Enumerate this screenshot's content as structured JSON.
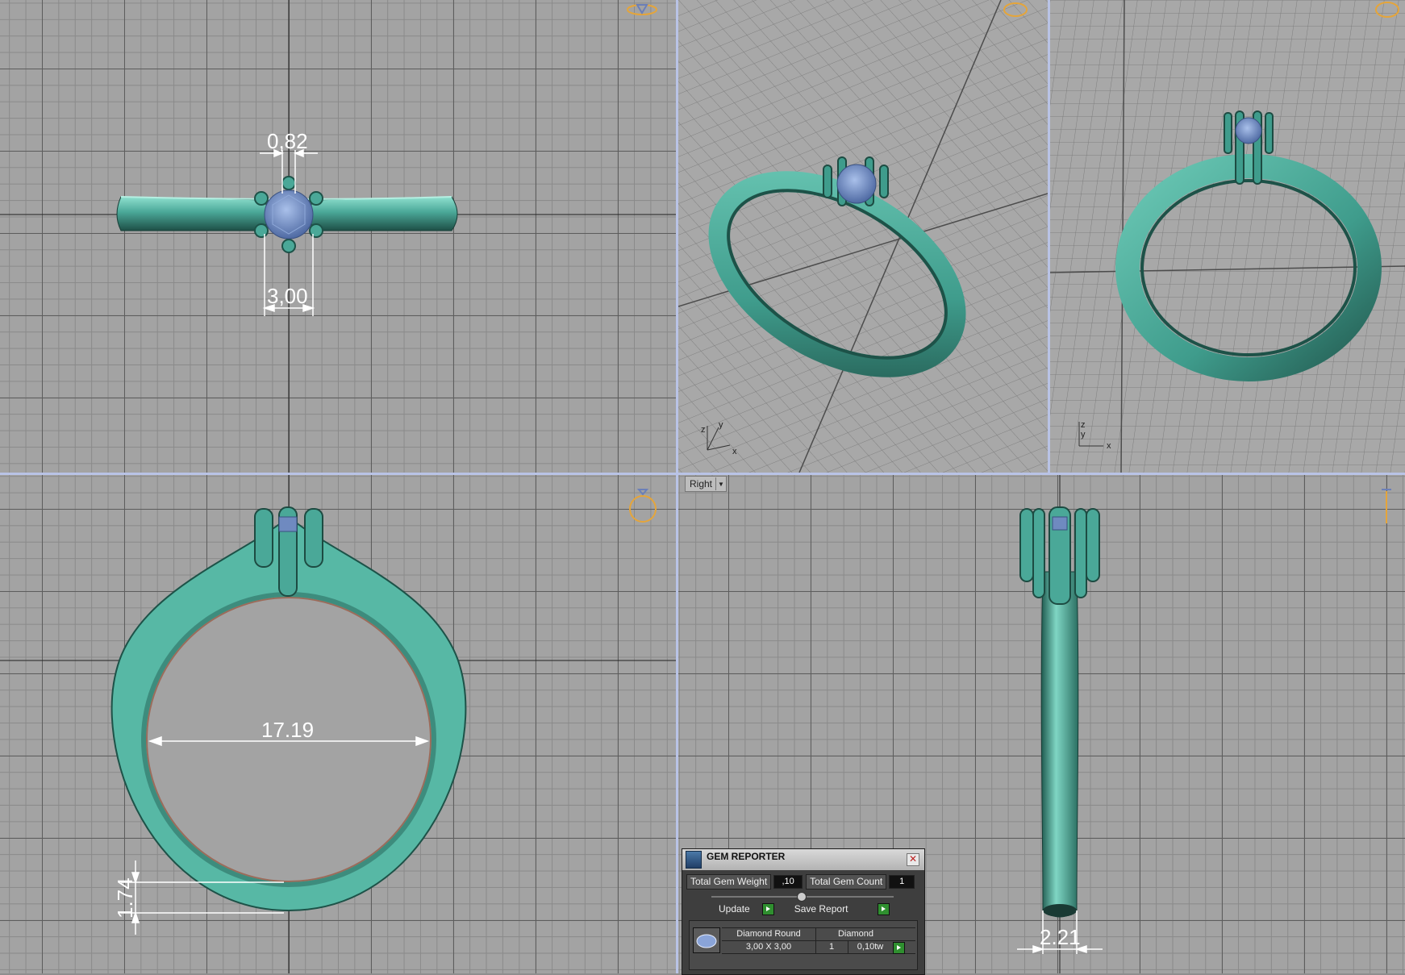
{
  "colors": {
    "ring": "#4aa898",
    "ring_dark": "#1d5248",
    "ring_light": "#7fd6c4",
    "gem": "#7b96c8",
    "gem_dark": "#45609a",
    "grid_bg": "#a3a3a3",
    "grid_major": "#5d5d5d",
    "grid_minor": "#8a8a8a",
    "dimension": "#ffffff",
    "nav_cube": "#e5a53a",
    "viewport_border": "#b9c3e6"
  },
  "viewports": {
    "top": {
      "dim_prong": "0,82",
      "dim_stone": "3,00"
    },
    "perspective1": {
      "axis_labels": [
        "z",
        "y",
        "x"
      ]
    },
    "perspective2": {
      "axis_labels": [
        "z",
        "y",
        "x"
      ]
    },
    "front": {
      "dim_inner": "17.19",
      "dim_band": "1.74"
    },
    "right": {
      "label": "Right",
      "dim_width": "2.21"
    }
  },
  "gem_reporter": {
    "title": "GEM REPORTER",
    "total_weight_label": "Total Gem Weight",
    "total_weight_value": ",10",
    "total_count_label": "Total Gem Count",
    "total_count_value": "1",
    "update_label": "Update",
    "save_report_label": "Save Report",
    "gems": [
      {
        "name": "Diamond Round",
        "material": "Diamond",
        "size": "3,00 X 3,00",
        "count": "1",
        "weight": "0,10tw"
      }
    ]
  }
}
